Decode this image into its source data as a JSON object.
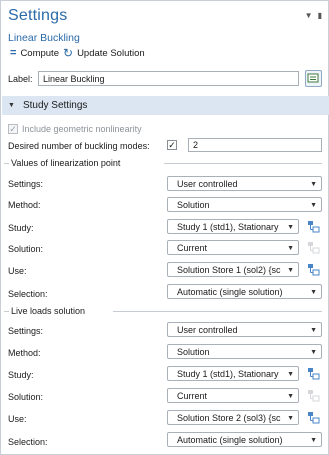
{
  "header": {
    "title": "Settings",
    "subtitle": "Linear Buckling",
    "compute_label": "Compute",
    "update_label": "Update Solution"
  },
  "label_field": {
    "label": "Label:",
    "value": "Linear Buckling"
  },
  "study_settings": {
    "title": "Study Settings",
    "include_nonlinearity_label": "Include geometric nonlinearity",
    "include_nonlinearity_checked": true,
    "buckling_modes_label": "Desired number of buckling modes:",
    "buckling_modes_checked": true,
    "buckling_modes_value": "2"
  },
  "linearization": {
    "title": "Values of linearization point",
    "rows": {
      "settings": {
        "label": "Settings:",
        "value": "User controlled"
      },
      "method": {
        "label": "Method:",
        "value": "Solution"
      },
      "study": {
        "label": "Study:",
        "value": "Study 1 (std1), Stationary"
      },
      "solution": {
        "label": "Solution:",
        "value": "Current"
      },
      "use": {
        "label": "Use:",
        "value": "Solution Store 1 (sol2) {sc"
      },
      "selection": {
        "label": "Selection:",
        "value": "Automatic (single solution)"
      }
    }
  },
  "live_loads": {
    "title": "Live loads solution",
    "rows": {
      "settings": {
        "label": "Settings:",
        "value": "User controlled"
      },
      "method": {
        "label": "Method:",
        "value": "Solution"
      },
      "study": {
        "label": "Study:",
        "value": "Study 1 (std1), Stationary"
      },
      "solution": {
        "label": "Solution:",
        "value": "Current"
      },
      "use": {
        "label": "Use:",
        "value": "Solution Store 2 (sol3) {sc"
      },
      "selection": {
        "label": "Selection:",
        "value": "Automatic (single solution)"
      }
    }
  },
  "colors": {
    "accent": "#2b6aa8",
    "section_bar": "#dce6f2",
    "border": "#a9b0ba"
  }
}
